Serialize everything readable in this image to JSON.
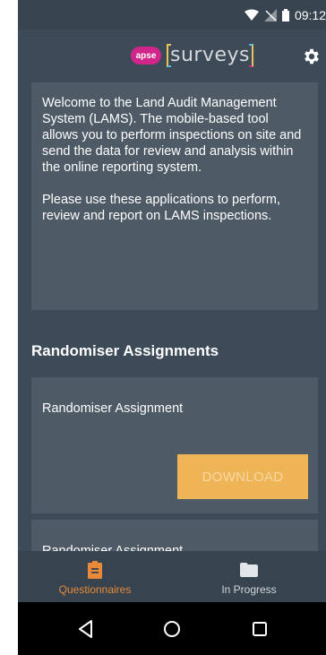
{
  "status_bar": {
    "time": "09:12"
  },
  "app_bar": {
    "brand_badge": "apse",
    "brand_name": "surveys"
  },
  "welcome": {
    "paragraph1": "Welcome to the Land Audit Management System (LAMS).  The mobile-based tool allows you to perform inspections on site and send the data for review and analysis within the online reporting system.",
    "paragraph2": "Please use these applications to perform, review and report on LAMS inspections."
  },
  "assignments": {
    "section_title": "Randomiser Assignments",
    "items": [
      {
        "label": "Randomiser Assignment",
        "action_label": "DOWNLOAD"
      },
      {
        "label": "Randomiser Assignment"
      }
    ]
  },
  "bottom_nav": {
    "tabs": [
      {
        "label": "Questionnaires",
        "icon": "clipboard-icon",
        "active": true
      },
      {
        "label": "In Progress",
        "icon": "folder-icon",
        "active": false
      }
    ]
  },
  "colors": {
    "background": "#3d4a57",
    "card": "#4e5a66",
    "accent": "#e88a3a",
    "button": "#eeb455",
    "brand_magenta": "#d0268c"
  }
}
